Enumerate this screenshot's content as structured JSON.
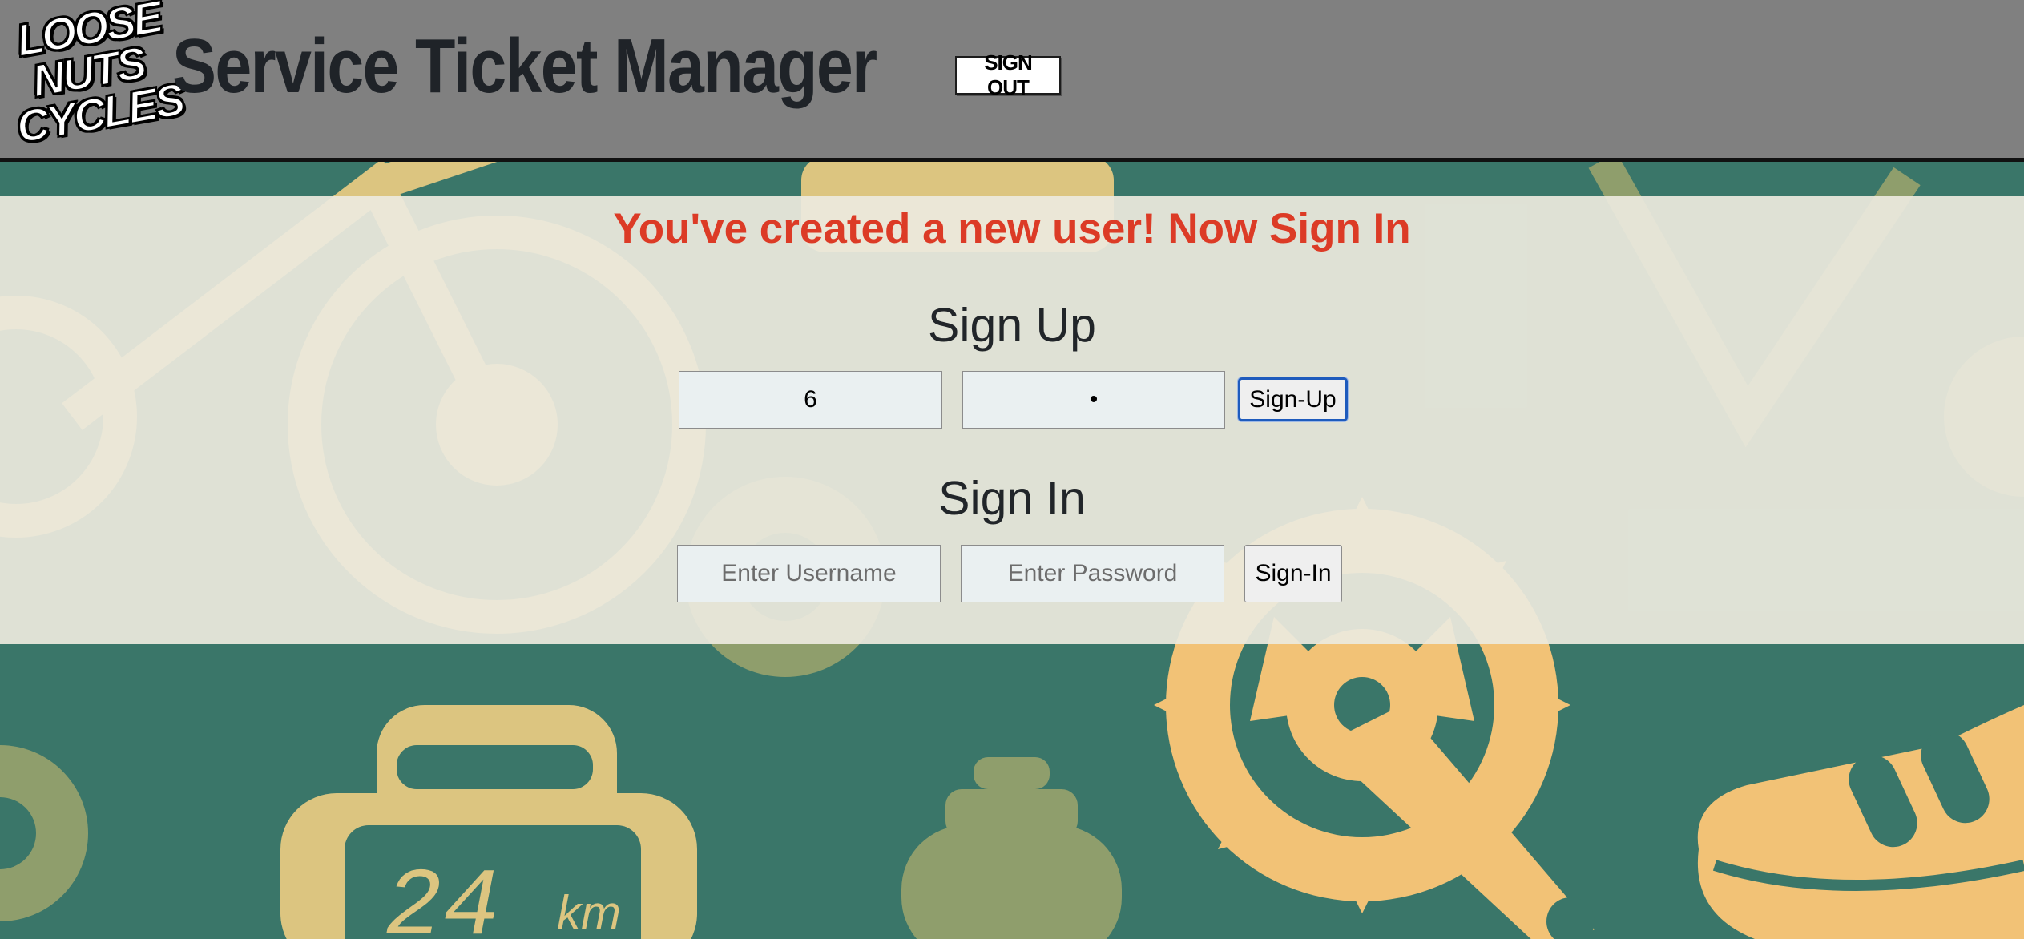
{
  "header": {
    "logo": {
      "lines": [
        "LOOSE",
        "NUTS",
        "CYCLES"
      ]
    },
    "title": "Service Ticket Manager",
    "sign_out_label": "SIGN OUT"
  },
  "main": {
    "success_message": "You've created a new user! Now Sign In",
    "sign_up": {
      "heading": "Sign Up",
      "username_value": "6",
      "password_value": "•",
      "button_label": "Sign-Up"
    },
    "sign_in": {
      "heading": "Sign In",
      "username_placeholder": "Enter Username",
      "password_placeholder": "Enter Password",
      "button_label": "Sign-In"
    }
  },
  "background": {
    "description_icons": [
      "bicycle-icon",
      "gear-icon",
      "bike-computer-icon",
      "water-bottle-icon",
      "chainring-crank-icon",
      "cycling-shoe-icon",
      "wheel-icon"
    ],
    "colors": {
      "base": "#3a7669",
      "yellow": "#dcc580",
      "orange": "#f2c276",
      "olive": "#8f9e6c"
    }
  },
  "colors": {
    "header_bg": "#808080",
    "title_text": "#1f2328",
    "success_text": "#dc3b26",
    "panel_bg": "#eceade"
  }
}
